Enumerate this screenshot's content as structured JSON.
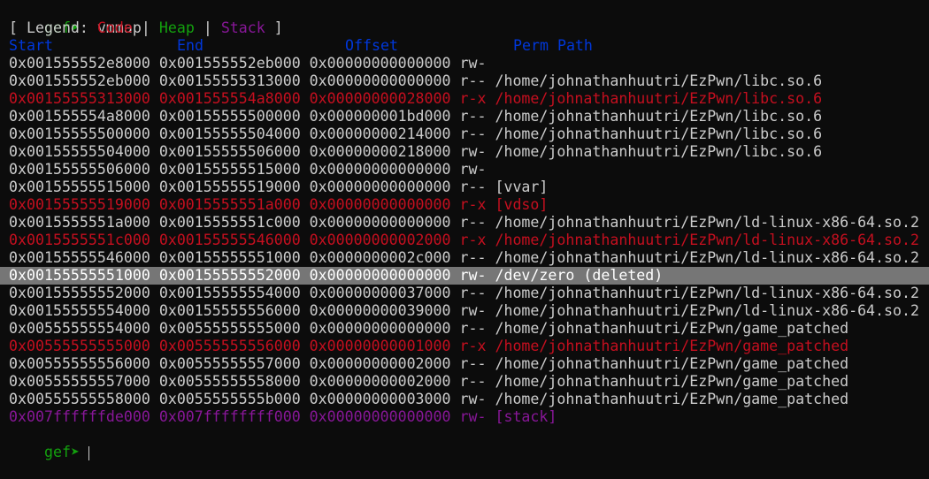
{
  "prompt": {
    "label": "gef➤",
    "command": "vmmap"
  },
  "legend": {
    "open": "[ Legend: ",
    "code": "Code",
    "sep1": " | ",
    "heap": "Heap",
    "sep2": " | ",
    "stack": "Stack",
    "close": " ]"
  },
  "header": {
    "start": "Start",
    "end": "End",
    "offset": "Offset",
    "perm_path": "Perm Path"
  },
  "colors": {
    "code": "#c50f1f",
    "heap": "#13a10e",
    "stack": "#881798",
    "header": "#0037da",
    "selection_bg": "#767676"
  },
  "rows": [
    {
      "text": "0x001555552e8000 0x001555552eb000 0x00000000000000 rw- ",
      "kind": "normal"
    },
    {
      "text": "0x001555552eb000 0x00155555313000 0x00000000000000 r-- /home/johnathanhuutri/EzPwn/libc.so.6",
      "kind": "normal"
    },
    {
      "text": "0x00155555313000 0x001555554a8000 0x00000000028000 r-x /home/johnathanhuutri/EzPwn/libc.so.6",
      "kind": "code"
    },
    {
      "text": "0x001555554a8000 0x00155555500000 0x000000001bd000 r-- /home/johnathanhuutri/EzPwn/libc.so.6",
      "kind": "normal"
    },
    {
      "text": "0x00155555500000 0x00155555504000 0x00000000214000 r-- /home/johnathanhuutri/EzPwn/libc.so.6",
      "kind": "normal"
    },
    {
      "text": "0x00155555504000 0x00155555506000 0x00000000218000 rw- /home/johnathanhuutri/EzPwn/libc.so.6",
      "kind": "normal"
    },
    {
      "text": "0x00155555506000 0x00155555515000 0x00000000000000 rw- ",
      "kind": "normal"
    },
    {
      "text": "0x00155555515000 0x00155555519000 0x00000000000000 r-- [vvar]",
      "kind": "normal"
    },
    {
      "text": "0x00155555519000 0x0015555551a000 0x00000000000000 r-x [vdso]",
      "kind": "code"
    },
    {
      "text": "0x0015555551a000 0x0015555551c000 0x00000000000000 r-- /home/johnathanhuutri/EzPwn/ld-linux-x86-64.so.2",
      "kind": "normal"
    },
    {
      "text": "0x0015555551c000 0x00155555546000 0x00000000002000 r-x /home/johnathanhuutri/EzPwn/ld-linux-x86-64.so.2",
      "kind": "code"
    },
    {
      "text": "0x00155555546000 0x00155555551000 0x0000000002c000 r-- /home/johnathanhuutri/EzPwn/ld-linux-x86-64.so.2",
      "kind": "normal"
    },
    {
      "text": "0x00155555551000 0x00155555552000 0x00000000000000 rw- /dev/zero (deleted)",
      "kind": "selected"
    },
    {
      "text": "0x00155555552000 0x00155555554000 0x00000000037000 r-- /home/johnathanhuutri/EzPwn/ld-linux-x86-64.so.2",
      "kind": "normal"
    },
    {
      "text": "0x00155555554000 0x00155555556000 0x00000000039000 rw- /home/johnathanhuutri/EzPwn/ld-linux-x86-64.so.2",
      "kind": "normal"
    },
    {
      "text": "0x00555555554000 0x00555555555000 0x00000000000000 r-- /home/johnathanhuutri/EzPwn/game_patched",
      "kind": "normal"
    },
    {
      "text": "0x00555555555000 0x00555555556000 0x00000000001000 r-x /home/johnathanhuutri/EzPwn/game_patched",
      "kind": "code"
    },
    {
      "text": "0x00555555556000 0x00555555557000 0x00000000002000 r-- /home/johnathanhuutri/EzPwn/game_patched",
      "kind": "normal"
    },
    {
      "text": "0x00555555557000 0x00555555558000 0x00000000002000 r-- /home/johnathanhuutri/EzPwn/game_patched",
      "kind": "normal"
    },
    {
      "text": "0x00555555558000 0x0055555555b000 0x00000000003000 rw- /home/johnathanhuutri/EzPwn/game_patched",
      "kind": "normal"
    },
    {
      "text": "0x007ffffffde000 0x007ffffffff000 0x00000000000000 rw- [stack]",
      "kind": "stack"
    }
  ],
  "next_prompt": {
    "label": "gef➤"
  }
}
